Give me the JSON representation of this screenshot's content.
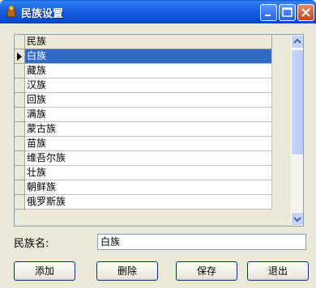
{
  "window": {
    "title": "民族设置"
  },
  "grid": {
    "column_header": "民族",
    "rows": [
      "白族",
      "藏族",
      "汉族",
      "回族",
      "满族",
      "蒙古族",
      "苗族",
      "维吾尔族",
      "壮族",
      "朝鲜族",
      "俄罗斯族"
    ],
    "selected_index": 0
  },
  "form": {
    "name_label": "民族名:",
    "name_value": "白族"
  },
  "buttons": {
    "add": "添加",
    "delete": "删除",
    "save": "保存",
    "exit": "退出"
  },
  "colors": {
    "titlebar": "#0a4fd2",
    "selection": "#316ac5",
    "dialog_bg": "#ece9d8"
  },
  "icons": [
    "app-icon",
    "minimize-icon",
    "maximize-icon",
    "close-icon",
    "row-pointer-icon",
    "scroll-up-icon",
    "scroll-down-icon"
  ]
}
